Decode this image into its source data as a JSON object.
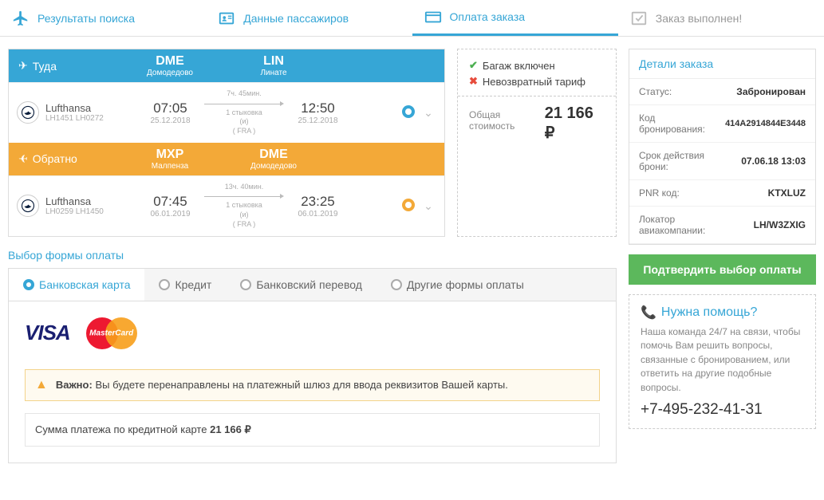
{
  "nav": [
    {
      "label": "Результаты поиска",
      "state": "done"
    },
    {
      "label": "Данные пассажиров",
      "state": "done"
    },
    {
      "label": "Оплата заказа",
      "state": "active"
    },
    {
      "label": "Заказ выполнен!",
      "state": ""
    }
  ],
  "outbound": {
    "dir_label": "Туда",
    "from_code": "DME",
    "from_name": "Домодедово",
    "to_code": "LIN",
    "to_name": "Линате",
    "airline": "Lufthansa",
    "flights": "LH1451  LH0272",
    "dep_time": "07:05",
    "dep_date": "25.12.2018",
    "arr_time": "12:50",
    "arr_date": "25.12.2018",
    "duration": "7ч. 45мин.",
    "stops": "1 стыковка",
    "and": "(и)",
    "via": "( FRA )"
  },
  "inbound": {
    "dir_label": "Обратно",
    "from_code": "MXP",
    "from_name": "Малпензa",
    "to_code": "DME",
    "to_name": "Домодедово",
    "airline": "Lufthansa",
    "flights": "LH0259  LH1450",
    "dep_time": "07:45",
    "dep_date": "06.01.2019",
    "arr_time": "23:25",
    "arr_date": "06.01.2019",
    "duration": "13ч. 40мин.",
    "stops": "1 стыковка",
    "and": "(и)",
    "via": "( FRA )"
  },
  "info": {
    "baggage": "Багаж включен",
    "nonref": "Невозвратный тариф",
    "total_label": "Общая стоимость",
    "total_value": "21 166 ₽"
  },
  "payment": {
    "section_title": "Выбор формы оплаты",
    "tabs": [
      "Банковская карта",
      "Кредит",
      "Банковский перевод",
      "Другие формы оплаты"
    ],
    "important_label": "Важно:",
    "important_text": "Вы будете перенаправлены на платежный шлюз для ввода реквизитов Вашей карты.",
    "sum_label": "Сумма платежа по кредитной карте ",
    "sum_value": "21 166  ₽"
  },
  "details": {
    "title": "Детали заказа",
    "rows": [
      {
        "k": "Статус:",
        "v": "Забронирован",
        "link": false
      },
      {
        "k": "Код бронирования:",
        "v": "414A2914844E3448",
        "link": false
      },
      {
        "k": "Срок действия брони:",
        "v": "07.06.18 13:03",
        "link": true
      },
      {
        "k": "PNR код:",
        "v": "KTXLUZ",
        "link": true
      },
      {
        "k": "Локатор авиакомпании:",
        "v": "LH/W3ZXIG",
        "link": true
      }
    ]
  },
  "confirm": "Подтвердить выбор оплаты",
  "help": {
    "title": "Нужна помощь?",
    "text": "Наша команда 24/7 на связи, чтобы помочь Вам решить вопросы, связанные с бронированием, или ответить на другие подобные вопросы.",
    "phone": "+7-495-232-41-31"
  }
}
